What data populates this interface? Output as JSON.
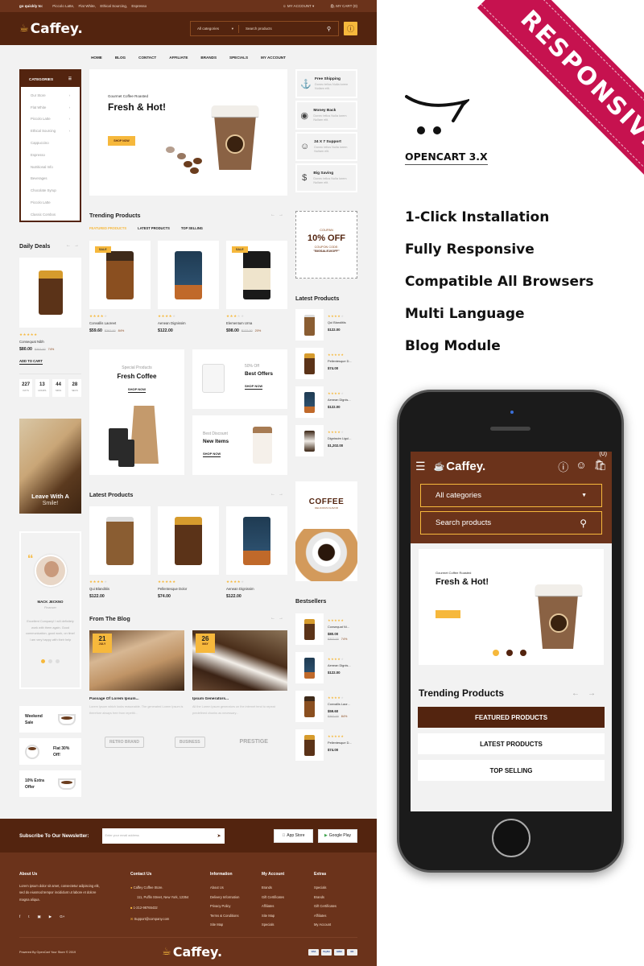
{
  "topbar": {
    "label": "go quickly to:",
    "links": [
      "Piccolo Latte,",
      "Flat White,",
      "Ethical Sourcing,",
      "Espresso"
    ],
    "account": "MY ACCOUNT",
    "cart": "MY CART (0)"
  },
  "header": {
    "logo": "Caffey.",
    "category_select": "All categories",
    "search_placeholder": "Search products"
  },
  "nav": [
    "HOME",
    "BLOG",
    "CONTACT",
    "AFFILIATE",
    "BRANDS",
    "SPECIALS",
    "MY ACCOUNT"
  ],
  "categories": {
    "title": "CATEGORIES",
    "items": [
      {
        "label": "Our Store",
        "has_sub": true
      },
      {
        "label": "Flat White",
        "has_sub": true
      },
      {
        "label": "Piccolo Latte",
        "has_sub": true
      },
      {
        "label": "Ethical Sourcing",
        "has_sub": true
      },
      {
        "label": "Cappuccino",
        "has_sub": false
      },
      {
        "label": "Espresso",
        "has_sub": false
      },
      {
        "label": "Nutritional Info",
        "has_sub": false
      },
      {
        "label": "Beverages",
        "has_sub": false
      },
      {
        "label": "Chocolate Syrup",
        "has_sub": false
      },
      {
        "label": "Piccolo Latte",
        "has_sub": false
      },
      {
        "label": "Classic Combos",
        "has_sub": false
      }
    ]
  },
  "hero": {
    "subtitle": "Gourmet Coffee Roasted",
    "title": "Fresh & Hot!",
    "button": "SHOP NOW"
  },
  "features": [
    {
      "title": "Free Shipping",
      "desc": "Donec tellus Nulla lorem Nullam elit.",
      "icon": "ship-icon"
    },
    {
      "title": "Money Back",
      "desc": "Donec tellus Nulla lorem Nullam elit.",
      "icon": "piggy-bank-icon"
    },
    {
      "title": "24 X 7 Support",
      "desc": "Donec tellus Nulla lorem Nullam elit.",
      "icon": "support-agent-icon"
    },
    {
      "title": "Big Saving",
      "desc": "Donec tellus Nulla lorem Nullam elit.",
      "icon": "saving-hand-icon"
    }
  ],
  "coupon": {
    "label": "COUPAN",
    "headline": "10% OFF",
    "code_label": "COUPON CODE:",
    "code": "\"BIGSALE10OFF\""
  },
  "trending": {
    "title": "Trending Products",
    "tabs": [
      "FEATURED PRODUCTS",
      "LATEST PRODUCTS",
      "TOP SELLING"
    ],
    "active_tab": 0,
    "products": [
      {
        "name": "Convallis Laoreet",
        "price": "$59.60",
        "old": "$362.00",
        "pct": "84%",
        "rating": 4,
        "sale": "SALE"
      },
      {
        "name": "Aenean Dignissim",
        "price": "$122.00",
        "old": "",
        "pct": "",
        "rating": 4,
        "sale": ""
      },
      {
        "name": "Elementum Urna",
        "price": "$98.00",
        "old": "$122.00",
        "pct": "20%",
        "rating": 3,
        "sale": "SALE"
      }
    ]
  },
  "daily_deals": {
    "title": "Daily Deals",
    "product": {
      "name": "Consequat Nibh",
      "price": "$80.00",
      "old": "$302.00",
      "pct": "74%",
      "rating": 5
    },
    "add_to_cart": "ADD TO CART",
    "countdown": [
      {
        "value": "227",
        "unit": "DAYS"
      },
      {
        "value": "13",
        "unit": "HOURS"
      },
      {
        "value": "44",
        "unit": "MINS"
      },
      {
        "value": "28",
        "unit": "SECS"
      }
    ]
  },
  "banners": {
    "fresh_coffee": {
      "sub": "Special Products",
      "title": "Fresh Coffee",
      "button": "SHOP NOW"
    },
    "best_offers": {
      "sub": "50% Off",
      "title": "Best Offers",
      "button": "SHOP NOW"
    },
    "new_items": {
      "sub": "Best Discount",
      "title": "New Items",
      "button": "SHOP NOW"
    }
  },
  "leave_banner": {
    "line1": "Leave With A",
    "line2": "Smile!"
  },
  "latest_side": {
    "title": "Latest Products",
    "items": [
      {
        "name": "Qui Blanditiis",
        "price": "$122.00",
        "rating": 4
      },
      {
        "name": "Pellentesque D...",
        "price": "$74.00",
        "rating": 5
      },
      {
        "name": "Aenean Dignis...",
        "price": "$122.00",
        "rating": 4
      },
      {
        "name": "Dignissim Ligul...",
        "price": "$1,202.00",
        "rating": 4
      }
    ]
  },
  "latest_main": {
    "title": "Latest Products",
    "products": [
      {
        "name": "Qui Blanditiis",
        "price": "$122.00",
        "rating": 4
      },
      {
        "name": "Pellentesque Dolor",
        "price": "$74.00",
        "rating": 5
      },
      {
        "name": "Aenean Dignissim",
        "price": "$122.00",
        "rating": 4
      }
    ]
  },
  "coffee_banner": {
    "title": "COFFEE",
    "sub": "DELICIOUS FLAVOR"
  },
  "testimonial": {
    "name": "MACK JECKNO",
    "role": "Financer",
    "text": "Excellent Company! I will definitely work with them again. Good communication, good work, on time! I am very happy with their help",
    "slide": 1,
    "slides": 3
  },
  "blog": {
    "title": "From The Blog",
    "posts": [
      {
        "day": "21",
        "month": "JULY",
        "title": "Passage Of Lorem Ipsum...",
        "excerpt": "Lorem Ipsum which looks reasonable. The generated Lorem Ipsum is therefore always free from repetiti..."
      },
      {
        "day": "26",
        "month": "MAY",
        "title": "Ipsum Generators...",
        "excerpt": "All the Lorem Ipsum generators on the internet tend to repeat predefined chunks as necessary..."
      }
    ]
  },
  "bestsellers": {
    "title": "Bestsellers",
    "items": [
      {
        "name": "Consequat Ni...",
        "price": "$80.00",
        "old": "$302.00",
        "pct": "74%",
        "rating": 5
      },
      {
        "name": "Aenean Dignis...",
        "price": "$122.00",
        "old": "",
        "pct": "",
        "rating": 4
      },
      {
        "name": "Convallis Laor...",
        "price": "$59.60",
        "old": "$362.00",
        "pct": "84%",
        "rating": 4
      },
      {
        "name": "Pellentesque D...",
        "price": "$74.00",
        "old": "",
        "pct": "",
        "rating": 5
      }
    ]
  },
  "offers": [
    {
      "title": "Weekend Sale"
    },
    {
      "title": "Flat 30% Off!"
    },
    {
      "title": "10% Extra Offer"
    }
  ],
  "brands": [
    "RETRO BRAND",
    "BUSINESS",
    "PRESTIGE"
  ],
  "newsletter": {
    "label": "Subscribe To Our Newsletter:",
    "placeholder": "Enter your email address",
    "app_store": "App Store",
    "google_play": "Google Play"
  },
  "footer": {
    "about": {
      "title": "About Us",
      "text": "Lorem ipsum dolor sit amet, consectetur adipiscing elit, sed do eiusmod tempor incididunt ut labore et dolore magna aliqua."
    },
    "contact": {
      "title": "Contact Us",
      "store": "Caffey Coffee Store.",
      "address": "111, Puffin Street, New York, 12354",
      "phone": "1-212-98765432",
      "email": "Support@company.com"
    },
    "information": {
      "title": "Information",
      "links": [
        "About Us",
        "Delivery Information",
        "Privacy Policy",
        "Terms & Conditions",
        "Site Map"
      ]
    },
    "account": {
      "title": "My Account",
      "links": [
        "Brands",
        "Gift Certificates",
        "Affiliates",
        "Site Map",
        "Specials"
      ]
    },
    "extras": {
      "title": "Extras",
      "links": [
        "Specials",
        "Brands",
        "Gift Certificates",
        "Affiliates",
        "My Account"
      ]
    },
    "powered": "Powered By OpenCart Your Store © 2019",
    "logo": "Caffey.",
    "payments": [
      "VISA",
      "PayPal",
      "AMEX",
      "MC"
    ]
  },
  "promo": {
    "ribbon": "RESPONSIVE",
    "platform": "OPENCART 3.X",
    "features": [
      "1-Click Installation",
      "Fully Responsive",
      "Compatible All Browsers",
      "Multi Language",
      "Blog Module"
    ]
  },
  "mobile": {
    "logo": "Caffey.",
    "cart_count": "(0)",
    "category": "All categories",
    "search": "Search products",
    "hero_sub": "Gourmet Coffee Roasted",
    "hero_title": "Fresh & Hot!",
    "section_title": "Trending Products",
    "tabs": [
      "FEATURED PRODUCTS",
      "LATEST PRODUCTS",
      "TOP SELLING"
    ],
    "slide": 1,
    "slides": 3
  },
  "colors": {
    "brand_dark": "#53240f",
    "brand": "#6b331b",
    "accent": "#f6b83c",
    "ribbon": "#c6124f"
  }
}
